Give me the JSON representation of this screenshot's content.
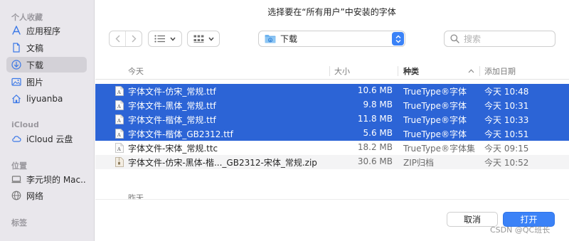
{
  "dialog": {
    "title": "选择要在“所有用户”中安装的字体"
  },
  "sidebar": {
    "sections": [
      {
        "label": "个人收藏",
        "items": [
          {
            "label": "应用程序",
            "icon": "applications-icon"
          },
          {
            "label": "文稿",
            "icon": "document-icon"
          },
          {
            "label": "下载",
            "icon": "download-icon",
            "active": true
          },
          {
            "label": "图片",
            "icon": "pictures-icon"
          },
          {
            "label": "liyuanba",
            "icon": "home-icon"
          }
        ]
      },
      {
        "label": "iCloud",
        "items": [
          {
            "label": "iCloud 云盘",
            "icon": "icloud-icon"
          }
        ]
      },
      {
        "label": "位置",
        "items": [
          {
            "label": "李元坝的 Mac...",
            "icon": "computer-icon"
          },
          {
            "label": "网络",
            "icon": "network-icon"
          }
        ]
      },
      {
        "label": "标签",
        "items": []
      }
    ]
  },
  "toolbar": {
    "location": "下载",
    "search_placeholder": "搜索"
  },
  "list": {
    "columns": {
      "name": "今天",
      "size": "大小",
      "kind": "种类",
      "date": "添加日期"
    },
    "rows": [
      {
        "name": "字体文件-仿宋_常规.ttf",
        "size": "10.6 MB",
        "kind": "TrueType®字体",
        "date": "今天 10:48",
        "selected": true,
        "type": "font"
      },
      {
        "name": "字体文件-黑体_常规.ttf",
        "size": "9.8 MB",
        "kind": "TrueType®字体",
        "date": "今天 10:31",
        "selected": true,
        "type": "font"
      },
      {
        "name": "字体文件-楷体_常规.ttf",
        "size": "11.8 MB",
        "kind": "TrueType®字体",
        "date": "今天 10:33",
        "selected": true,
        "type": "font"
      },
      {
        "name": "字体文件-楷体_GB2312.ttf",
        "size": "5.6 MB",
        "kind": "TrueType®字体",
        "date": "今天 10:51",
        "selected": true,
        "type": "font"
      },
      {
        "name": "字体文件-宋体_常规.ttc",
        "size": "18.2 MB",
        "kind": "TrueType®字体集",
        "date": "今天 09:15",
        "selected": false,
        "type": "font"
      },
      {
        "name": "字体文件-仿宋-黑体-楷..._GB2312-宋体_常规.zip",
        "size": "30.6 MB",
        "kind": "ZIP归档",
        "date": "今天 10:52",
        "selected": false,
        "type": "zip"
      }
    ],
    "next_group": "昨天"
  },
  "buttons": {
    "cancel": "取消",
    "open": "打开"
  },
  "watermark": "CSDN @QC班长",
  "colors": {
    "selection": "#2c64d6",
    "accent": "#3b82f7",
    "sidebar_bg": "#e9e7ec"
  }
}
